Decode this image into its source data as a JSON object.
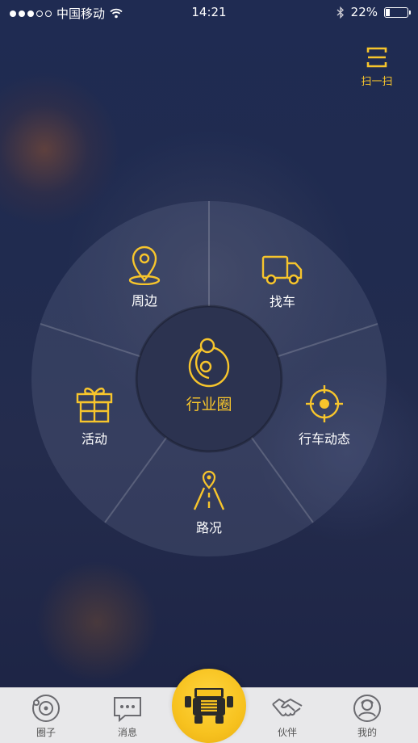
{
  "status_bar": {
    "carrier": "中国移动",
    "time": "14:21",
    "battery": "22%",
    "battery_level": 0.22,
    "signal_bars": 3,
    "signal_total": 5
  },
  "scan": {
    "label": "扫一扫",
    "icon": "scan-icon"
  },
  "wheel": {
    "center": {
      "label": "行业圈",
      "icon": "orbit-circle-icon"
    },
    "items": [
      {
        "label": "周边",
        "icon": "location-pin-icon"
      },
      {
        "label": "找车",
        "icon": "truck-icon"
      },
      {
        "label": "行车动态",
        "icon": "target-crosshair-icon"
      },
      {
        "label": "路况",
        "icon": "road-icon"
      },
      {
        "label": "活动",
        "icon": "gift-icon"
      }
    ]
  },
  "tabbar": {
    "tabs": [
      {
        "label": "圈子",
        "icon": "circle-orbit-icon"
      },
      {
        "label": "消息",
        "icon": "chat-bubble-icon"
      },
      {
        "label": "伙伴",
        "icon": "handshake-icon"
      },
      {
        "label": "我的",
        "icon": "profile-icon"
      }
    ],
    "center_icon": "truck-front-icon"
  },
  "colors": {
    "accent": "#f7c52c",
    "background": "#1f2b52",
    "tabbar": "#e8e8ea"
  }
}
